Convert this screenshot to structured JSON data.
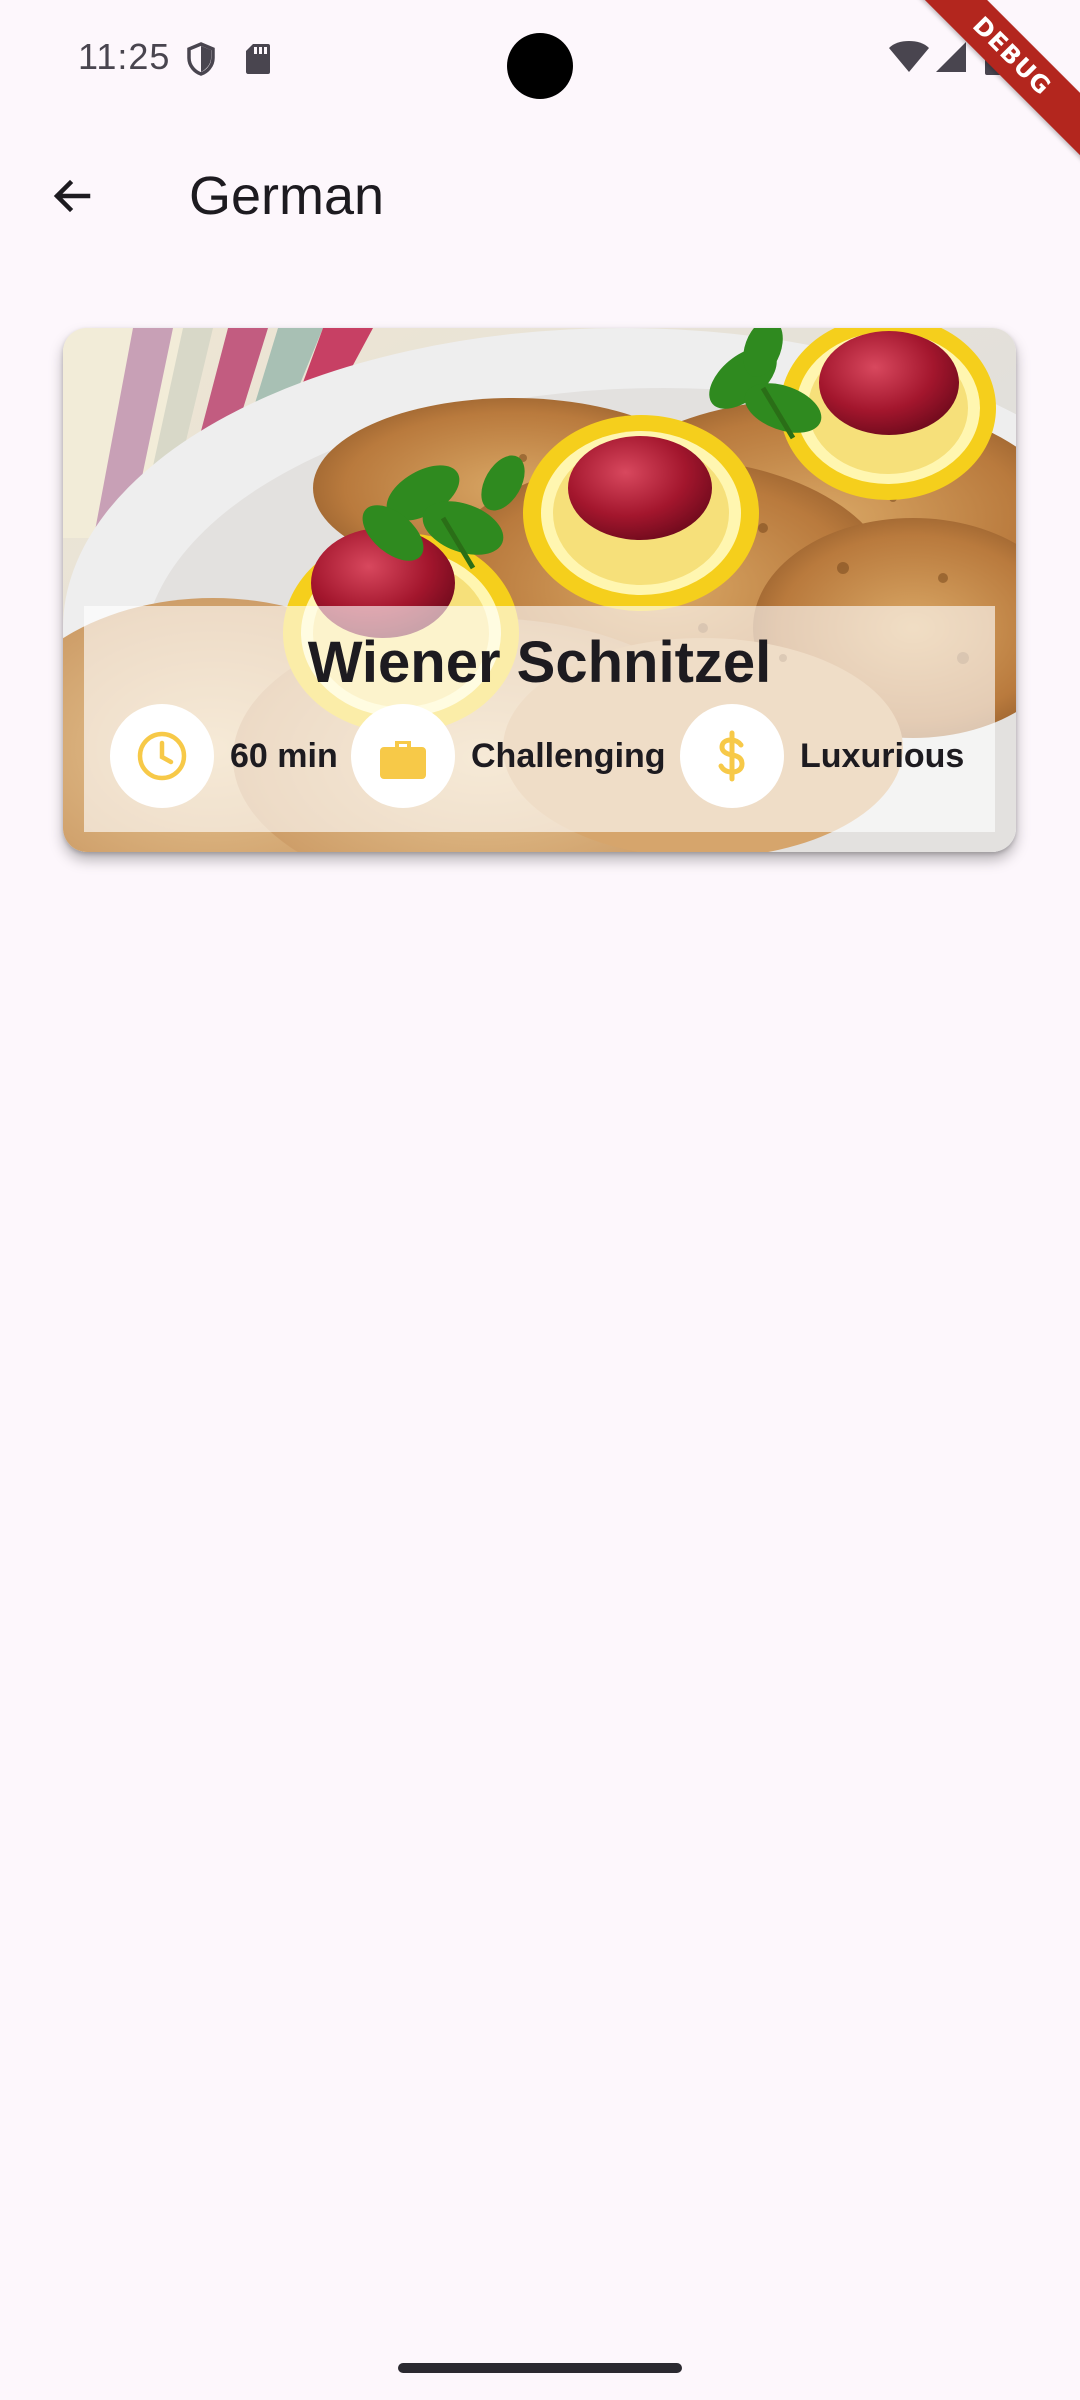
{
  "status_bar": {
    "time": "11:25",
    "icons": [
      "shield-icon",
      "sd-card-icon",
      "wifi-icon",
      "signal-icon",
      "battery-icon"
    ]
  },
  "debug_banner": "DEBUG",
  "app_bar": {
    "back_icon": "arrow-back-icon",
    "title": "German"
  },
  "meal": {
    "title": "Wiener Schnitzel",
    "image_description_icon": "schnitzel-photo",
    "traits": [
      {
        "icon": "clock-icon",
        "label": "60 min"
      },
      {
        "icon": "briefcase-icon",
        "label": "Challenging"
      },
      {
        "icon": "dollar-icon",
        "label": "Luxurious"
      }
    ]
  },
  "colors": {
    "background": "#fdf7fc",
    "accent": "#f7c948",
    "text": "#1d1b20"
  }
}
